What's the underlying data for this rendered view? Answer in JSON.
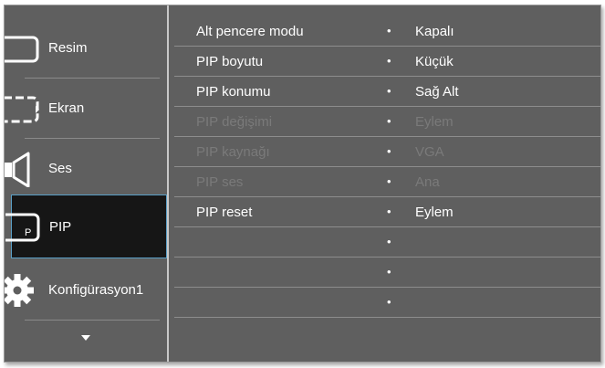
{
  "sidebar": {
    "items": [
      {
        "label": "Resim",
        "icon": "picture-icon"
      },
      {
        "label": "Ekran",
        "icon": "screen-icon"
      },
      {
        "label": "Ses",
        "icon": "speaker-icon"
      },
      {
        "label": "PIP",
        "icon": "pip-icon",
        "selected": true
      },
      {
        "label": "Konfigürasyon1",
        "icon": "gear-icon"
      }
    ],
    "scroll_icon": "down-arrow-icon"
  },
  "settings": {
    "rows": [
      {
        "name": "Alt pencere modu",
        "value": "Kapalı",
        "enabled": true
      },
      {
        "name": "PIP boyutu",
        "value": "Küçük",
        "enabled": true
      },
      {
        "name": "PIP konumu",
        "value": "Sağ Alt",
        "enabled": true
      },
      {
        "name": "PIP değişimi",
        "value": "Eylem",
        "enabled": false
      },
      {
        "name": "PIP kaynağı",
        "value": "VGA",
        "enabled": false
      },
      {
        "name": "PIP ses",
        "value": "Ana",
        "enabled": false
      },
      {
        "name": "PIP reset",
        "value": "Eylem",
        "enabled": true
      },
      {
        "name": "",
        "value": "",
        "enabled": true
      },
      {
        "name": "",
        "value": "",
        "enabled": true
      },
      {
        "name": "",
        "value": "",
        "enabled": true
      }
    ],
    "bullet": "•"
  },
  "colors": {
    "panel_bg": "#5f5f5f",
    "selected_bg": "#161616",
    "selected_border": "#5aa0c8",
    "text": "#ffffff",
    "disabled_text": "#7a7a7a"
  }
}
